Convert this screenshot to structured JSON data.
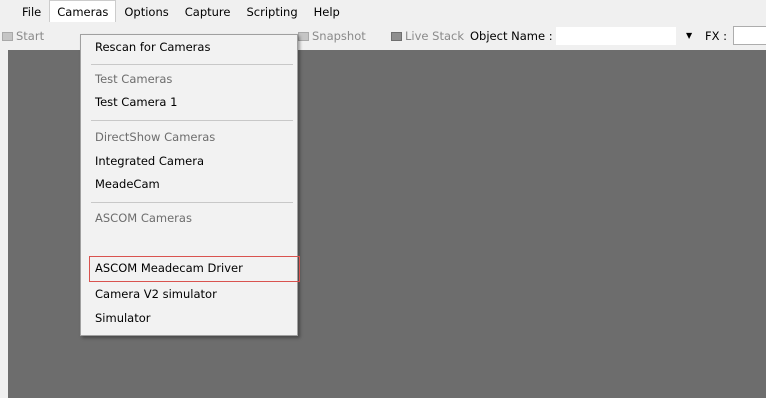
{
  "menubar": {
    "items": [
      "File",
      "Cameras",
      "Options",
      "Capture",
      "Scripting",
      "Help"
    ]
  },
  "toolbar": {
    "start_label": "Start",
    "snapshot_label": "Snapshot",
    "livestack_label": "Live Stack",
    "object_name_label": "Object Name :",
    "object_name_value": "",
    "fx_label": "FX :",
    "fx_value": ""
  },
  "cameras_menu": {
    "rescan_label": "Rescan for Cameras",
    "test_group_label": "Test Cameras",
    "test_camera_1_label": "Test Camera 1",
    "directshow_group_label": "DirectShow Cameras",
    "integrated_camera_label": "Integrated Camera",
    "meadecam_label": "MeadeCam",
    "ascom_group_label": "ASCOM Cameras",
    "ascom_meadecam_label": "ASCOM Meadecam Driver",
    "camera_v2_label": "Camera V2 simulator",
    "simulator_label": "Simulator",
    "highlighted_item": "ASCOM Meadecam Driver"
  },
  "colors": {
    "workspace_bg": "#6d6d6d",
    "menu_bg": "#f2f2f2",
    "highlight_border": "#d9534f"
  }
}
